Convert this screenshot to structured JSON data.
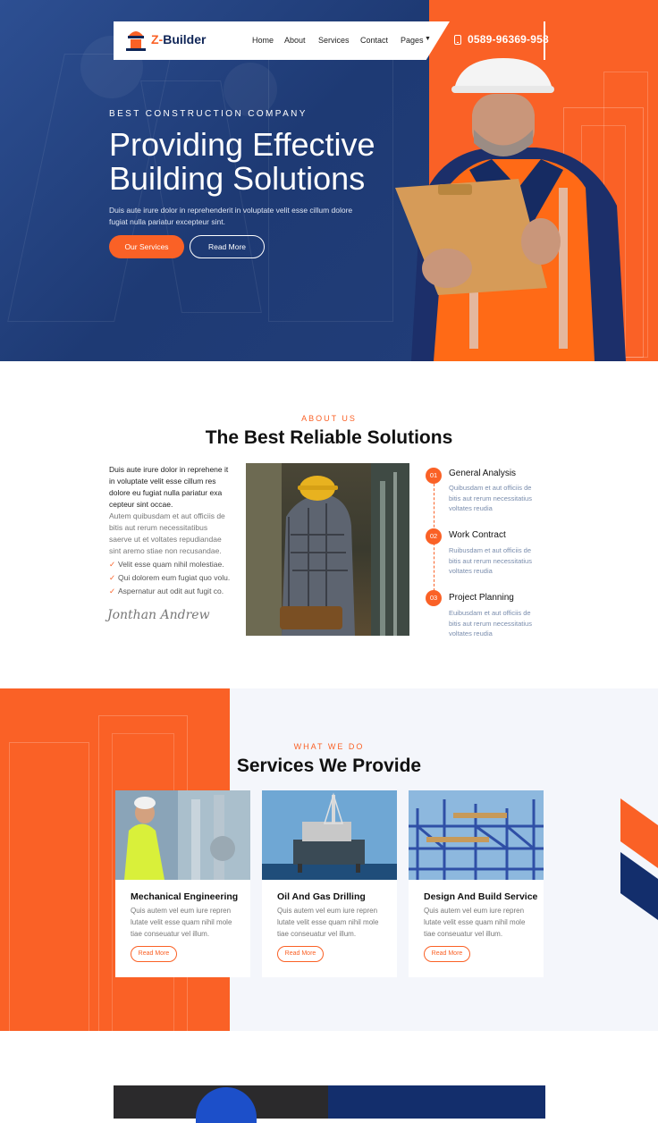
{
  "brand": {
    "name_prefix": "Z-",
    "name_suffix": "Builder",
    "color_orange": "#fa6126",
    "color_navy": "#0f2557"
  },
  "nav": {
    "items": [
      {
        "label": "Home"
      },
      {
        "label": "About"
      },
      {
        "label": "Services"
      },
      {
        "label": "Contact"
      },
      {
        "label": "Pages"
      }
    ],
    "phone": "0589-96369-958",
    "phone_icon": "phone-icon",
    "pages_icon": "caret-down-icon"
  },
  "hero": {
    "kicker": "BEST CONSTRUCTION COMPANY",
    "title_line1": "Providing Effective",
    "title_line2": "Building Solutions",
    "description": "Duis aute irure dolor in reprehenderit in voluptate velit esse cillum dolore fugiat nulla pariatur excepteur sint.",
    "btn_primary": "Our Services",
    "btn_secondary": "Read More"
  },
  "about": {
    "kicker": "ABOUT US",
    "title": "The Best Reliable Solutions",
    "p1": "Duis aute irure dolor in reprehene it in voluptate velit esse cillum res dolore eu fugiat nulla pariatur exa cepteur sint occae.",
    "p2": "Autem quibusdam et aut officiis de bitis aut rerum necessitatibus saerve ut et voltates repudiandae sint aremo stiae non recusandae.",
    "checklist": [
      "Velit esse quam nihil molestiae.",
      "Qui dolorem eum fugiat quo volu.",
      "Aspernatur aut odit aut fugit co."
    ],
    "signature": "Jonthan Andrew",
    "steps": [
      {
        "num": "01",
        "title": "General Analysis",
        "desc": "Quibusdam et aut officiis de bitis aut rerum necessitatius voltates reudia"
      },
      {
        "num": "02",
        "title": "Work Contract",
        "desc": "Ruibusdam et aut officiis de bitis aut rerum necessitatius voltates reudia"
      },
      {
        "num": "03",
        "title": "Project Planning",
        "desc": "Euibusdam et aut officiis de bitis aut rerum necessitatius voltates reudia"
      }
    ]
  },
  "services": {
    "kicker": "WHAT WE DO",
    "title": "Services We Provide",
    "cards": [
      {
        "title": "Mechanical Engineering",
        "desc": "Quis autem vel eum iure repren lutate velit esse quam nihil mole tiae conseuatur vel illum.",
        "btn": "Read More"
      },
      {
        "title": "Oil And Gas Drilling",
        "desc": "Quis autem vel eum iure repren lutate velit esse quam nihil mole tiae conseuatur vel illum.",
        "btn": "Read More"
      },
      {
        "title": "Design And Build Service",
        "desc": "Quis autem vel eum iure repren lutate velit esse quam nihil mole tiae conseuatur vel illum.",
        "btn": "Read More"
      }
    ]
  }
}
